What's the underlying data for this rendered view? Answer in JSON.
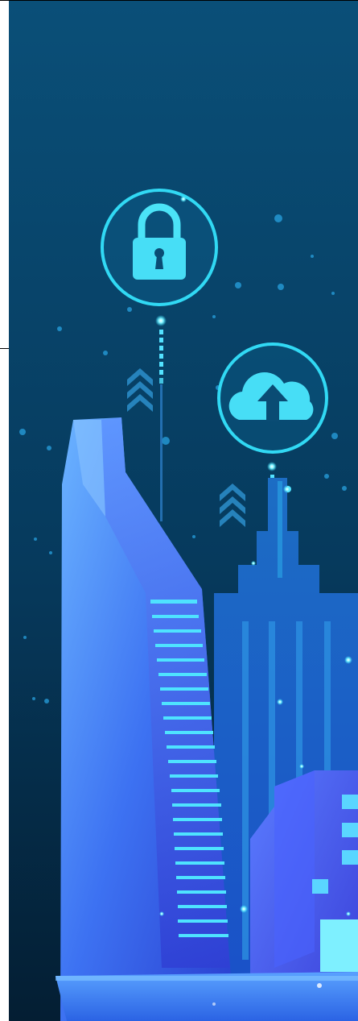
{
  "illustration": {
    "colors": {
      "sky_top": "#0a4f7a",
      "sky_bottom": "#04263c",
      "glow": "#2ee0ff",
      "building_light": "#6ab7ff",
      "building_mid": "#3b72f5",
      "building_dark": "#2a3fd6",
      "ground": "#3a82ff"
    },
    "icons": [
      "lock-icon",
      "cloud-upload-icon",
      "chevron-up-icon"
    ]
  }
}
